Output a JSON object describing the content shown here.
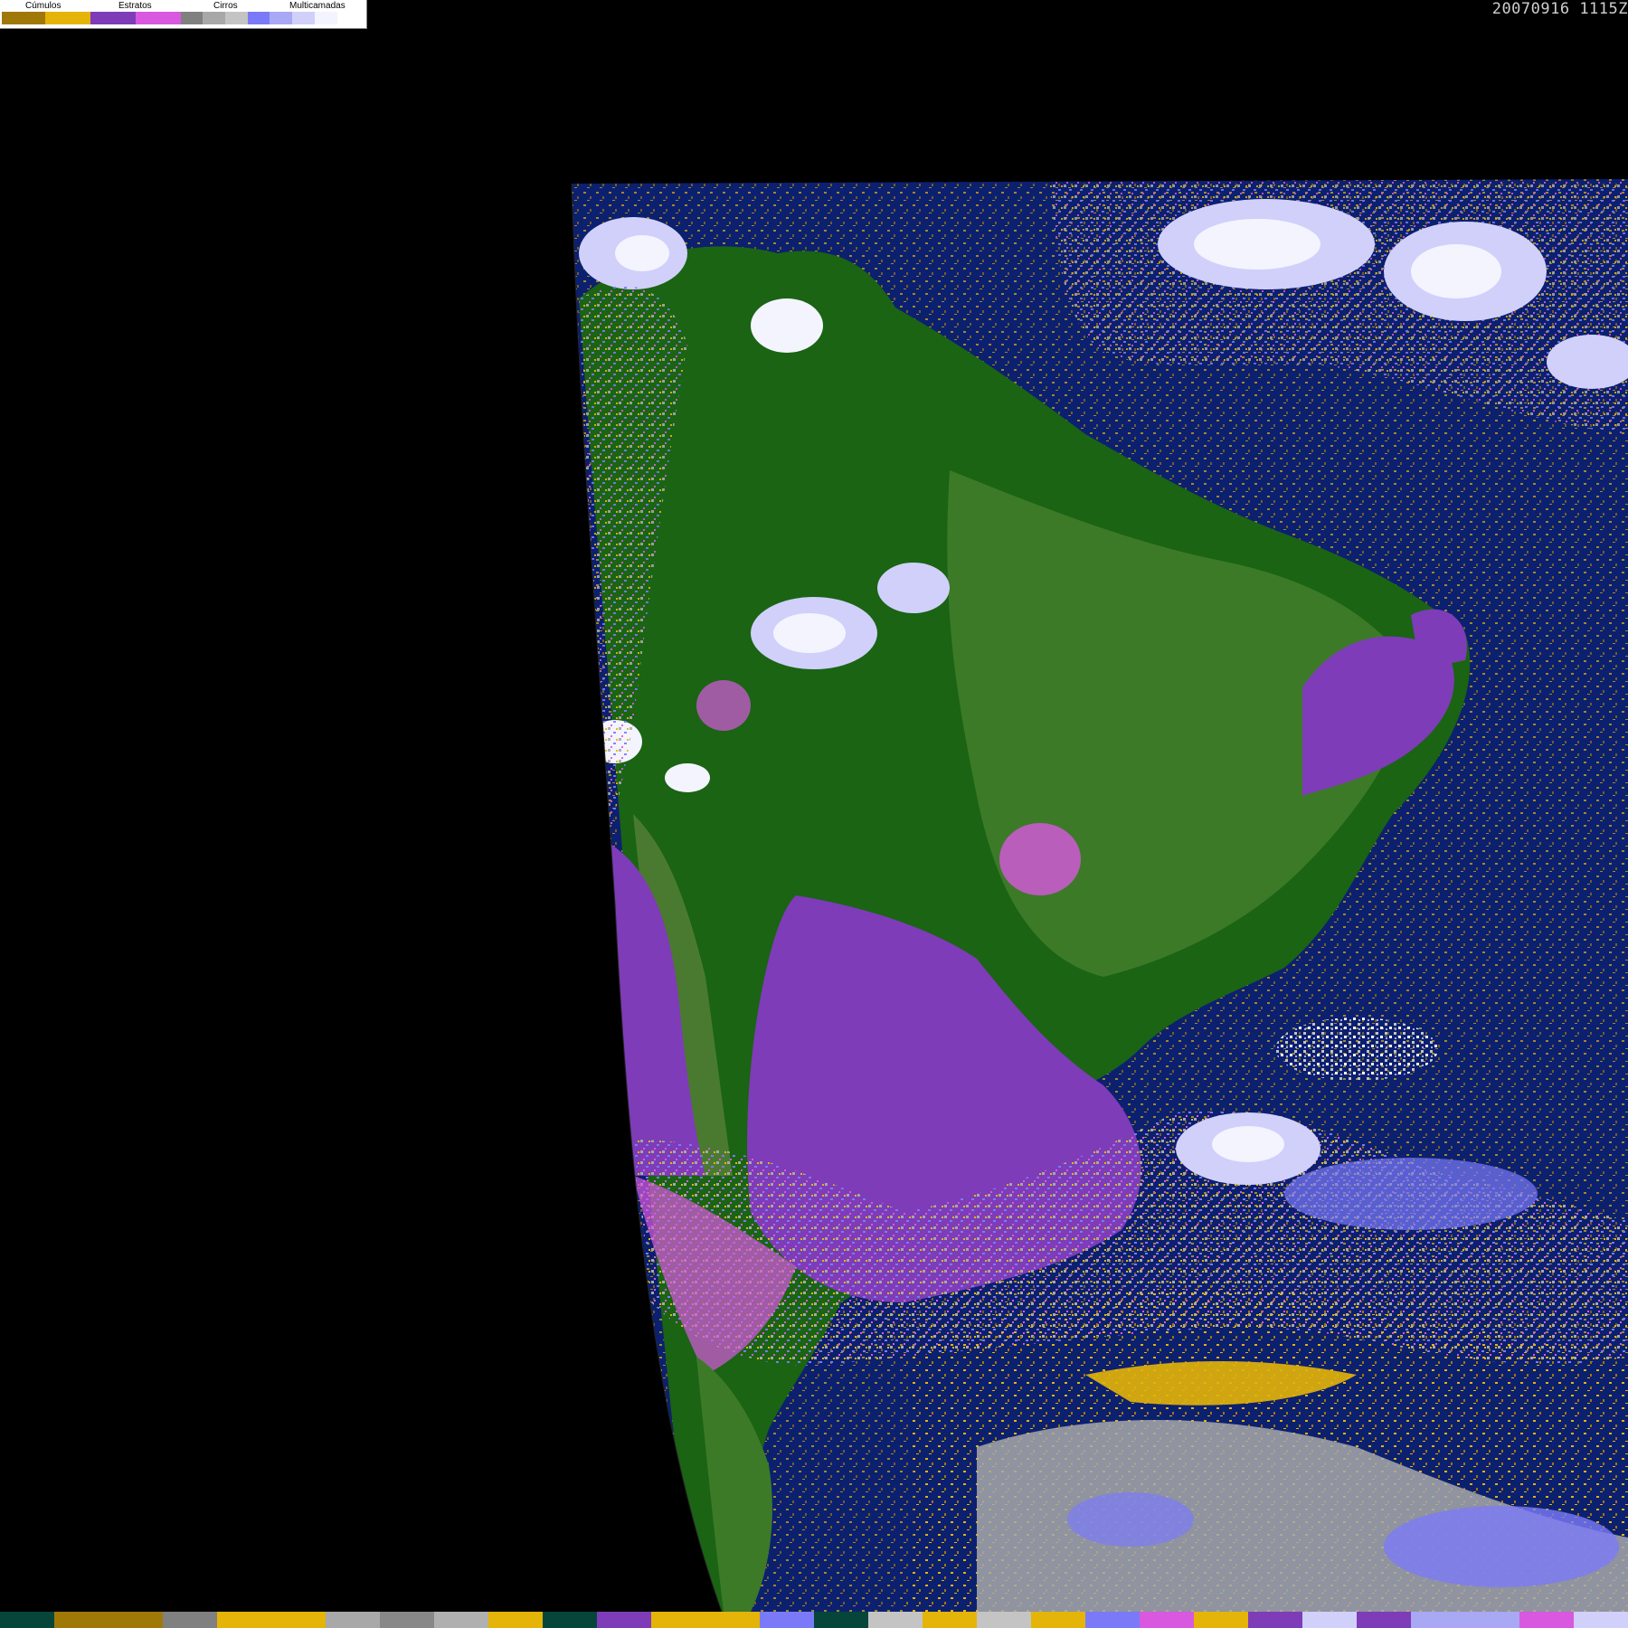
{
  "legend": {
    "groups": [
      {
        "label": "Cúmulos",
        "colors": [
          "#a07808",
          "#e4b408"
        ]
      },
      {
        "label": "Estratos",
        "colors": [
          "#7e3cb8",
          "#d858e0"
        ]
      },
      {
        "label": "Cirros",
        "colors": [
          "#808080",
          "#a8a8a8",
          "#c4c4c4"
        ]
      },
      {
        "label": "Multicamadas",
        "colors": [
          "#7a7af8",
          "#a8a8f4",
          "#d0d0fa",
          "#f4f4ff"
        ]
      }
    ]
  },
  "timestamp": "20070916 1115Z",
  "palette": {
    "space": "#000000",
    "ocean": "#0c2070",
    "land_forest": "#1a6414",
    "land_dry": "#3c7a28",
    "cumulus_low": "#a07808",
    "cumulus_high": "#e4b408",
    "stratus": "#7e3cb8",
    "stratus_pink": "#d858e0",
    "cirrus": "#a8a8a8",
    "multilayer": "#7a7af8",
    "multilayer_light": "#d0d0fa",
    "white": "#f4f4ff"
  },
  "strip_colors": [
    "#06463a",
    "#a07808",
    "#a07808",
    "#808080",
    "#e4b408",
    "#e4b408",
    "#a8a8a8",
    "#888888",
    "#b0b0b0",
    "#e4b408",
    "#06463a",
    "#7e3cb8",
    "#e4b408",
    "#e4b408",
    "#7a7af8",
    "#06463a",
    "#c4c4c4",
    "#e4b408",
    "#c4c4c4",
    "#e4b408",
    "#7a7af8",
    "#d858e0",
    "#e4b408",
    "#7e3cb8",
    "#d0d0fa",
    "#7e3cb8",
    "#a8a8f4",
    "#a8a8f4",
    "#d858e0",
    "#d0d0fa"
  ]
}
